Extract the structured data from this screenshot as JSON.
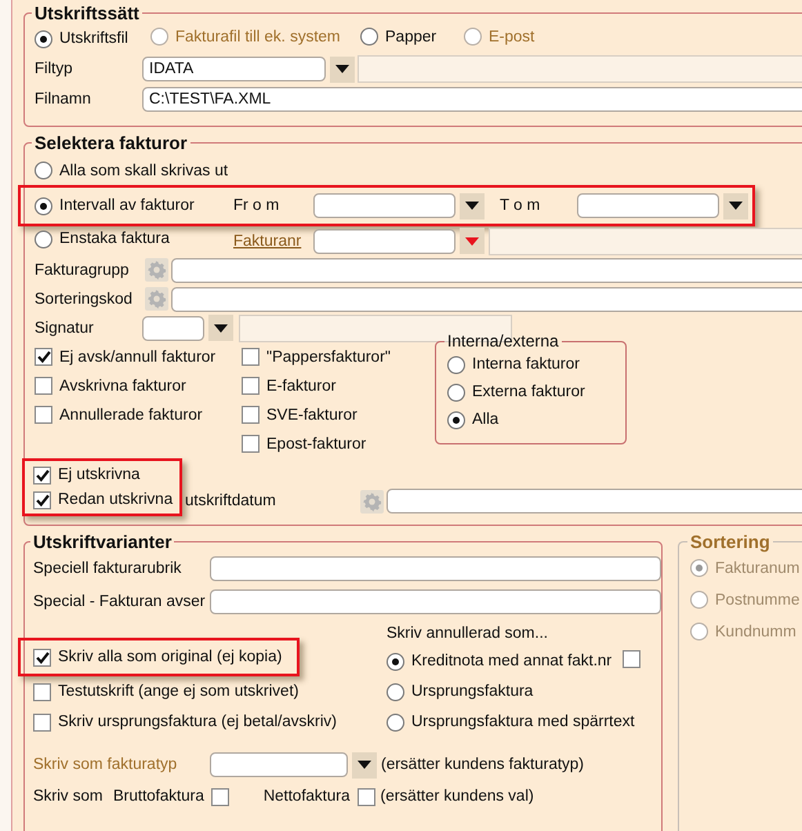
{
  "output_method": {
    "title": "Utskriftssätt",
    "options": [
      {
        "label": "Utskriftsfil",
        "selected": true,
        "disabled": false
      },
      {
        "label": "Fakturafil till ek. system",
        "selected": false,
        "disabled": true
      },
      {
        "label": "Papper",
        "selected": false,
        "disabled": false
      },
      {
        "label": "E-post",
        "selected": false,
        "disabled": true
      }
    ],
    "filetype": {
      "label": "Filtyp",
      "value": "IDATA"
    },
    "filename": {
      "label": "Filnamn",
      "value": "C:\\TEST\\FA.XML"
    }
  },
  "select_invoices": {
    "title": "Selektera fakturor",
    "all": {
      "label": "Alla som skall skrivas ut",
      "selected": false
    },
    "interval": {
      "label": "Intervall av fakturor",
      "selected": true,
      "highlighted": true,
      "from_label": "Fr o m",
      "to_label": "T o m"
    },
    "single": {
      "label": "Enstaka faktura",
      "selected": false,
      "link": "Fakturanr"
    },
    "group_label": "Fakturagrupp",
    "sortcode_label": "Sorteringskod",
    "signature_label": "Signatur",
    "checks_col1": [
      {
        "label": "Ej avsk/annull fakturor",
        "checked": true
      },
      {
        "label": "Avskrivna fakturor",
        "checked": false
      },
      {
        "label": "Annullerade fakturor",
        "checked": false
      }
    ],
    "checks_col2": [
      {
        "label": "\"Pappersfakturor\"",
        "checked": false
      },
      {
        "label": "E-fakturor",
        "checked": false
      },
      {
        "label": "SVE-fakturor",
        "checked": false
      },
      {
        "label": "Epost-fakturor",
        "checked": false
      }
    ],
    "internal_external": {
      "title": "Interna/externa",
      "options": [
        {
          "label": "Interna fakturor",
          "selected": false
        },
        {
          "label": "Externa fakturor",
          "selected": false
        },
        {
          "label": "Alla",
          "selected": true
        }
      ]
    },
    "printed": {
      "highlighted": true,
      "items": [
        {
          "label": "Ej utskrivna",
          "checked": true
        },
        {
          "label": "Redan utskrivna",
          "checked": true
        }
      ]
    },
    "print_date_label": "utskriftdatum"
  },
  "variants": {
    "title": "Utskriftvarianter",
    "fields": [
      {
        "label": "Speciell fakturarubrik"
      },
      {
        "label": "Special - Fakturan avser"
      }
    ],
    "checks": [
      {
        "label": "Skriv alla som original (ej kopia)",
        "checked": true,
        "highlighted": true
      },
      {
        "label": "Testutskrift (ange ej som utskrivet)",
        "checked": false,
        "highlighted": false
      },
      {
        "label": "Skriv ursprungsfaktura (ej betal/avskriv)",
        "checked": false,
        "highlighted": false
      }
    ],
    "cancelled": {
      "title": "Skriv annullerad som...",
      "options": [
        {
          "label": "Kreditnota med annat fakt.nr",
          "selected": true
        },
        {
          "label": "Ursprungsfaktura",
          "selected": false
        },
        {
          "label": "Ursprungsfaktura med spärrtext",
          "selected": false
        }
      ],
      "new_number_checked": false
    },
    "invoice_type": {
      "label": "Skriv som fakturatyp",
      "disabled": true,
      "note": "(ersätter kundens fakturatyp)"
    },
    "write_as": {
      "label": "Skriv som",
      "options": [
        {
          "label": "Bruttofaktura",
          "checked": false
        },
        {
          "label": "Nettofaktura",
          "checked": false
        }
      ],
      "note": "(ersätter kundens val)"
    }
  },
  "sorting": {
    "title": "Sortering",
    "disabled": true,
    "options": [
      {
        "label": "Fakturanum",
        "selected": true
      },
      {
        "label": "Postnumme",
        "selected": false
      },
      {
        "label": "Kundnumm",
        "selected": false
      }
    ]
  }
}
